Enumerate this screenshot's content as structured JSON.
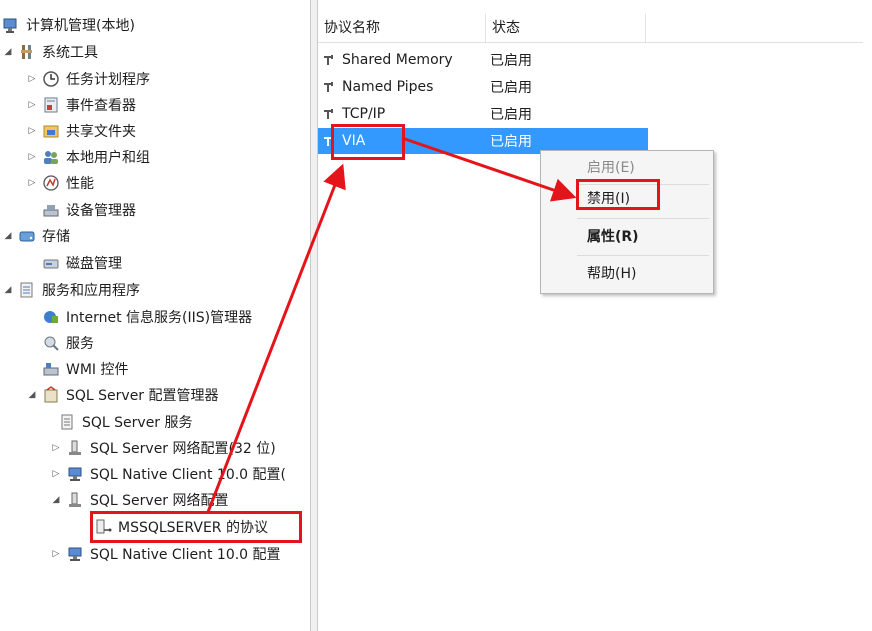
{
  "tree": {
    "items": [
      {
        "label": "计算机管理(本地)",
        "icon": "computer-management-icon",
        "expander": ""
      },
      {
        "label": "系统工具",
        "icon": "system-tools-icon",
        "expander": "◢"
      },
      {
        "label": "任务计划程序",
        "icon": "task-scheduler-icon",
        "expander": "▷"
      },
      {
        "label": "事件查看器",
        "icon": "event-viewer-icon",
        "expander": "▷"
      },
      {
        "label": "共享文件夹",
        "icon": "shared-folders-icon",
        "expander": "▷"
      },
      {
        "label": "本地用户和组",
        "icon": "users-groups-icon",
        "expander": "▷"
      },
      {
        "label": "性能",
        "icon": "performance-icon",
        "expander": "▷"
      },
      {
        "label": "设备管理器",
        "icon": "device-manager-icon",
        "expander": ""
      },
      {
        "label": "存储",
        "icon": "storage-icon",
        "expander": "◢"
      },
      {
        "label": "磁盘管理",
        "icon": "disk-management-icon",
        "expander": ""
      },
      {
        "label": "服务和应用程序",
        "icon": "services-apps-icon",
        "expander": "◢"
      },
      {
        "label": "Internet 信息服务(IIS)管理器",
        "icon": "iis-icon",
        "expander": ""
      },
      {
        "label": "服务",
        "icon": "services-icon",
        "expander": ""
      },
      {
        "label": "WMI 控件",
        "icon": "wmi-icon",
        "expander": ""
      },
      {
        "label": "SQL Server 配置管理器",
        "icon": "sql-config-manager-icon",
        "expander": "◢"
      },
      {
        "label": "SQL Server 服务",
        "icon": "sql-services-icon",
        "expander": ""
      },
      {
        "label": "SQL Server 网络配置(32 位)",
        "icon": "network-config-icon",
        "expander": "▷"
      },
      {
        "label": "SQL Native Client 10.0 配置(",
        "icon": "native-client-icon",
        "expander": "▷"
      },
      {
        "label": "SQL Server 网络配置",
        "icon": "network-config-icon",
        "expander": "◢"
      },
      {
        "label": "MSSQLSERVER 的协议",
        "icon": "protocols-icon",
        "expander": ""
      },
      {
        "label": "SQL Native Client 10.0 配置",
        "icon": "native-client-icon",
        "expander": "▷"
      }
    ]
  },
  "list": {
    "columns": [
      "协议名称",
      "状态"
    ],
    "rows": [
      {
        "name": "Shared Memory",
        "status": "已启用"
      },
      {
        "name": "Named Pipes",
        "status": "已启用"
      },
      {
        "name": "TCP/IP",
        "status": "已启用"
      },
      {
        "name": "VIA",
        "status": "已启用"
      }
    ]
  },
  "context_menu": {
    "enable": "启用(E)",
    "disable": "禁用(I)",
    "properties": "属性(R)",
    "help": "帮助(H)"
  },
  "colors": {
    "selection": "#3399ff",
    "annotation": "#e3151a"
  }
}
